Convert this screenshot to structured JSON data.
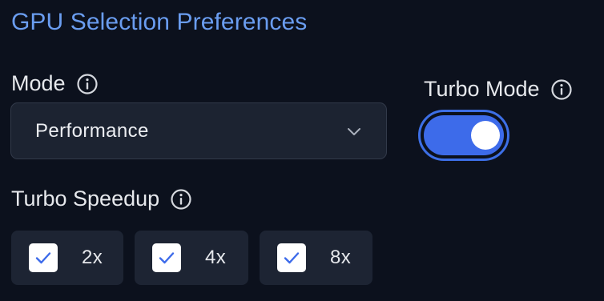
{
  "title": "GPU Selection Preferences",
  "mode": {
    "label": "Mode",
    "info_icon": "info-icon",
    "selected": "Performance",
    "chevron_icon": "chevron-down-icon"
  },
  "turbo_mode": {
    "label": "Turbo Mode",
    "info_icon": "info-icon",
    "enabled": true
  },
  "turbo_speedup": {
    "label": "Turbo Speedup",
    "info_icon": "info-icon",
    "options": [
      {
        "label": "2x",
        "checked": true
      },
      {
        "label": "4x",
        "checked": true
      },
      {
        "label": "8x",
        "checked": true
      }
    ]
  },
  "colors": {
    "background": "#0c111d",
    "title": "#6a9df0",
    "accent": "#3d6bea",
    "control_bg": "#1c2331"
  }
}
